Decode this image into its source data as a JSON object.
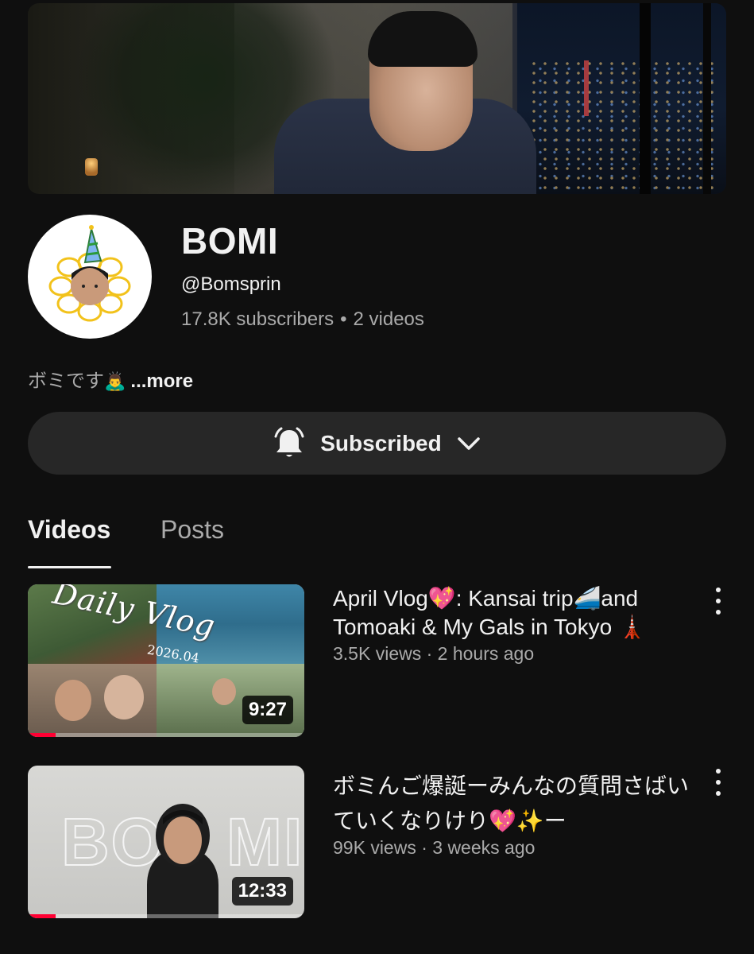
{
  "channel": {
    "name": "BOMI",
    "handle": "@Bomsprin",
    "subscribers": "17.8K subscribers",
    "separator": "•",
    "video_count": "2 videos",
    "description": "ボミです",
    "description_emoji": "🙇‍♂️",
    "more_label": "...more"
  },
  "subscribe_button": {
    "label": "Subscribed",
    "bell_icon": "bell-icon",
    "chevron_icon": "chevron-down-icon"
  },
  "tabs": [
    {
      "label": "Videos",
      "active": true
    },
    {
      "label": "Posts",
      "active": false
    }
  ],
  "videos": [
    {
      "title": "April Vlog💖: Kansai trip🚄and Tomoaki & My Gals in Tokyo 🗼",
      "meta": "3.5K views · 2 hours ago",
      "duration": "9:27",
      "progress": 0.1,
      "thumb_text": "Daily Vlog",
      "thumb_date": "2026.04"
    },
    {
      "title": "ボミんご爆誕ーみんなの質問さばいていくなりけり💖✨ー",
      "meta": "99K views · 3 weeks ago",
      "duration": "12:33",
      "progress": 0.1,
      "thumb_text_left": "BO",
      "thumb_text_right": "MI"
    }
  ],
  "colors": {
    "background": "#0f0f0f",
    "button": "#272727",
    "text": "#f1f1f1",
    "secondary_text": "#aaaaaa",
    "progress": "#ff0033"
  }
}
